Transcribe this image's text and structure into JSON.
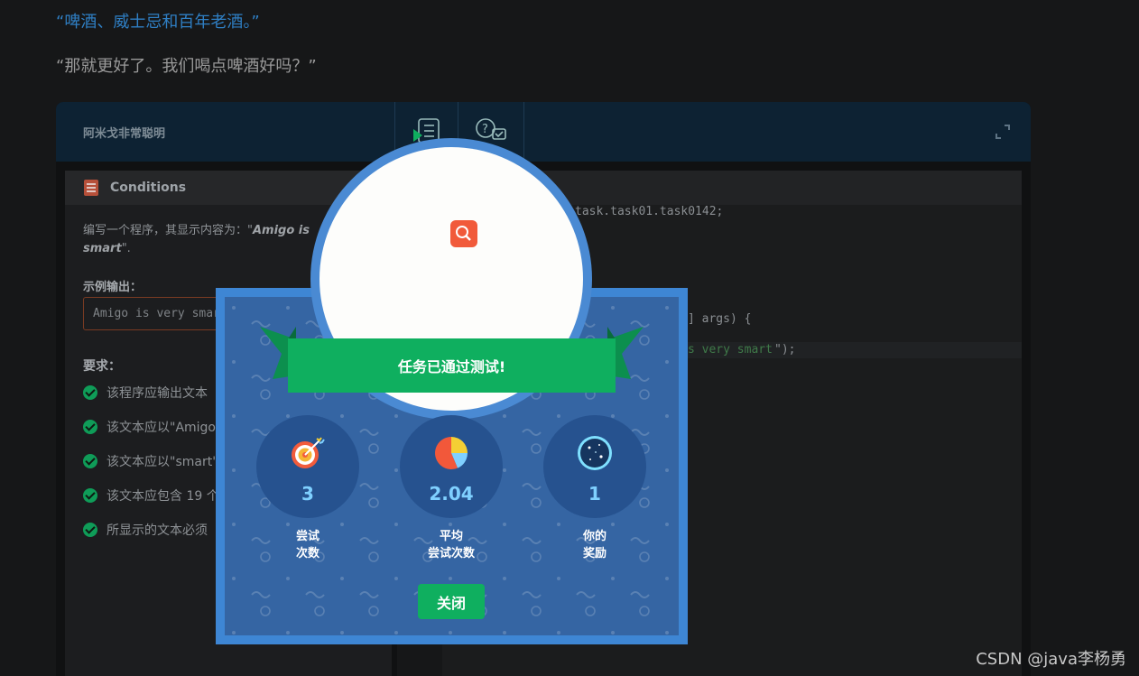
{
  "article": {
    "quote1": "“啤酒、威士忌和百年老酒。”",
    "quote2": "“那就更好了。我们喝点啤酒好吗？”"
  },
  "ide": {
    "title": "阿米戈非常聪明",
    "conditions": {
      "header": "Conditions",
      "description_prefix": "编写一个程序，其显示内容为：\"",
      "description_bold1": "Amigo is",
      "description_bold2": "smart",
      "description_suffix": "\".",
      "sample_label": "示例输出：",
      "sample_output": "Amigo is very smart",
      "requirements_label": "要求：",
      "requirements": [
        "该程序应输出文本",
        "该文本应以\"Amigo",
        "该文本应以\"smart\"",
        "该文本应包含 19 个",
        "所显示的文本必须"
      ]
    },
    "code": {
      "line_package": "task.task01.task0142;",
      "line_main": "] args) {",
      "line_print_str": "s very smart",
      "line_print_end": "\");"
    }
  },
  "dialog": {
    "title": "任务已通过测试!",
    "stats": [
      {
        "value": "3",
        "label_line1": "尝试",
        "label_line2": "次数",
        "icon": "target-icon"
      },
      {
        "value": "2.04",
        "label_line1": "平均",
        "label_line2": "尝试次数",
        "icon": "pie-chart-icon"
      },
      {
        "value": "1",
        "label_line1": "你的",
        "label_line2": "奖励",
        "icon": "dark-matter-icon"
      }
    ],
    "close_label": "关闭",
    "colors": {
      "accent": "#0faf5f",
      "frame": "#3e86d4",
      "panel": "#3565a3"
    }
  },
  "watermark": "CSDN @java李杨勇"
}
